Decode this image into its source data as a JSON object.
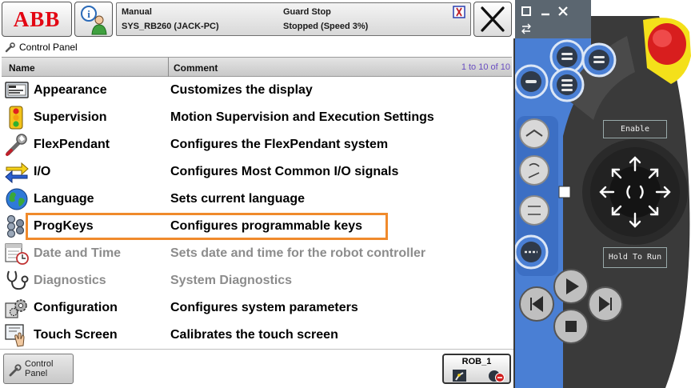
{
  "header": {
    "logo": "ABB",
    "mode": "Manual",
    "system": "SYS_RB260 (JACK-PC)",
    "guard_status": "Guard Stop",
    "run_status": "Stopped (Speed 3%)"
  },
  "breadcrumb": {
    "label": "Control Panel"
  },
  "table": {
    "col_name": "Name",
    "col_comment": "Comment",
    "range": "1 to 10 of 10",
    "rows": [
      {
        "name": "Appearance",
        "comment": "Customizes the display",
        "icon": "display-icon",
        "enabled": true
      },
      {
        "name": "Supervision",
        "comment": "Motion Supervision and Execution Settings",
        "icon": "traffic-light-icon",
        "enabled": true
      },
      {
        "name": "FlexPendant",
        "comment": "Configures the FlexPendant system",
        "icon": "wrench-icon",
        "enabled": true
      },
      {
        "name": "I/O",
        "comment": "Configures Most Common I/O signals",
        "icon": "io-arrows-icon",
        "enabled": true
      },
      {
        "name": "Language",
        "comment": "Sets current language",
        "icon": "globe-icon",
        "enabled": true
      },
      {
        "name": "ProgKeys",
        "comment": "Configures programmable keys",
        "icon": "keys-icon",
        "enabled": true,
        "highlighted": true
      },
      {
        "name": "Date and Time",
        "comment": "Sets date and time for the robot controller",
        "icon": "calendar-clock-icon",
        "enabled": false
      },
      {
        "name": "Diagnostics",
        "comment": "System Diagnostics",
        "icon": "stethoscope-icon",
        "enabled": false
      },
      {
        "name": "Configuration",
        "comment": "Configures system parameters",
        "icon": "config-gears-icon",
        "enabled": true
      },
      {
        "name": "Touch Screen",
        "comment": "Calibrates the touch screen",
        "icon": "touch-hand-icon",
        "enabled": true
      }
    ]
  },
  "taskbar": {
    "control_panel_label": "Control Panel",
    "robot_label": "ROB_1"
  },
  "pendant": {
    "enable_label": "Enable",
    "hold_to_run_label": "Hold To Run"
  },
  "colors": {
    "abb_red": "#e30613",
    "highlight": "#f08a2c",
    "range_text": "#6a4ec2",
    "pendant_blue": "#4a7fd4",
    "pendant_body": "#3a3a3a"
  }
}
